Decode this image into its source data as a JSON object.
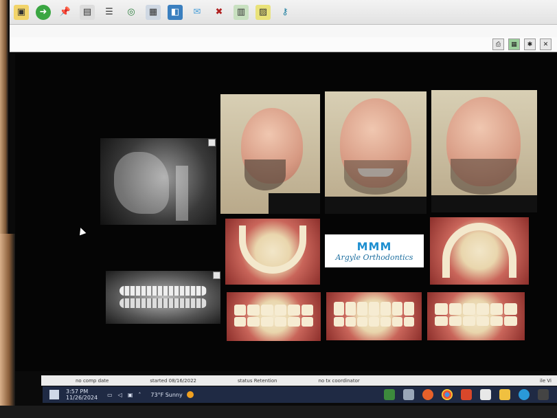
{
  "toolbar": {
    "icons": [
      "folder-icon",
      "next-arrow-icon",
      "pin-icon",
      "image-icon",
      "list-icon",
      "globe-icon",
      "keyboard-icon",
      "photo-icon",
      "mail-icon",
      "shield-icon",
      "document-icon",
      "chart-doc-icon",
      "key-icon"
    ]
  },
  "window_controls": [
    "print-icon",
    "grid-icon",
    "settings-icon",
    "close-icon"
  ],
  "logo": {
    "wordmark": "MMM",
    "text": "Argyle Orthodontics"
  },
  "status": {
    "comp_date": "no comp date",
    "started": "started 08/16/2022",
    "status": "status Retention",
    "coordinator": "no tx coordinator",
    "right": "ile Vi"
  },
  "taskbar": {
    "time": "3:57 PM",
    "date": "11/26/2024",
    "weather": "73°F Sunny",
    "accent": "#f0a020"
  }
}
